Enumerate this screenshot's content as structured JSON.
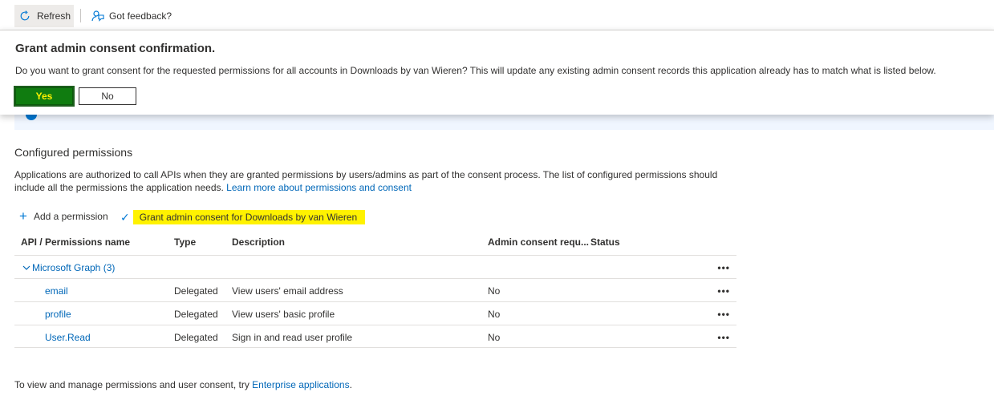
{
  "toolbar": {
    "refresh_label": "Refresh",
    "feedback_label": "Got feedback?"
  },
  "dialog": {
    "title": "Grant admin consent confirmation.",
    "message": "Do you want to grant consent for the requested permissions for all accounts in Downloads by van Wieren? This will update any existing admin consent records this application already has to match what is listed below.",
    "yes_label": "Yes",
    "no_label": "No"
  },
  "section": {
    "title": "Configured permissions",
    "description": "Applications are authorized to call APIs when they are granted permissions by users/admins as part of the consent process. The list of configured permissions should include all the permissions the application needs.",
    "learn_more_link": "Learn more about permissions and consent"
  },
  "actions": {
    "add_permission": "Add a permission",
    "grant_consent": "Grant admin consent for Downloads by van Wieren"
  },
  "table": {
    "headers": {
      "name": "API / Permissions name",
      "type": "Type",
      "description": "Description",
      "admin_consent": "Admin consent requ...",
      "status": "Status"
    },
    "group": {
      "label": "Microsoft Graph (3)",
      "more": "•••"
    },
    "rows": [
      {
        "name": "email",
        "type": "Delegated",
        "description": "View users' email address",
        "admin_consent": "No",
        "more": "•••"
      },
      {
        "name": "profile",
        "type": "Delegated",
        "description": "View users' basic profile",
        "admin_consent": "No",
        "more": "•••"
      },
      {
        "name": "User.Read",
        "type": "Delegated",
        "description": "Sign in and read user profile",
        "admin_consent": "No",
        "more": "•••"
      }
    ]
  },
  "footer": {
    "text": "To view and manage permissions and user consent, try",
    "link": "Enterprise applications",
    "end": "."
  },
  "colors": {
    "accent": "#0078d4",
    "link": "#0067b8",
    "yes_button": "#107c10",
    "highlight": "#fff200"
  }
}
